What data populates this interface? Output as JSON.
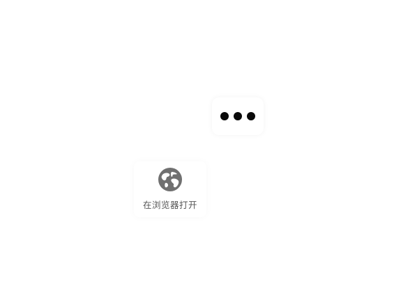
{
  "menu": {
    "more_button": {
      "icon": "more-dots-icon"
    }
  },
  "share_options": [
    {
      "icon": "globe-icon",
      "label": "在浏览器打开"
    }
  ],
  "colors": {
    "background": "#ffffff",
    "dots": "#0a0a0a",
    "icon": "#707070",
    "label": "#555555"
  }
}
